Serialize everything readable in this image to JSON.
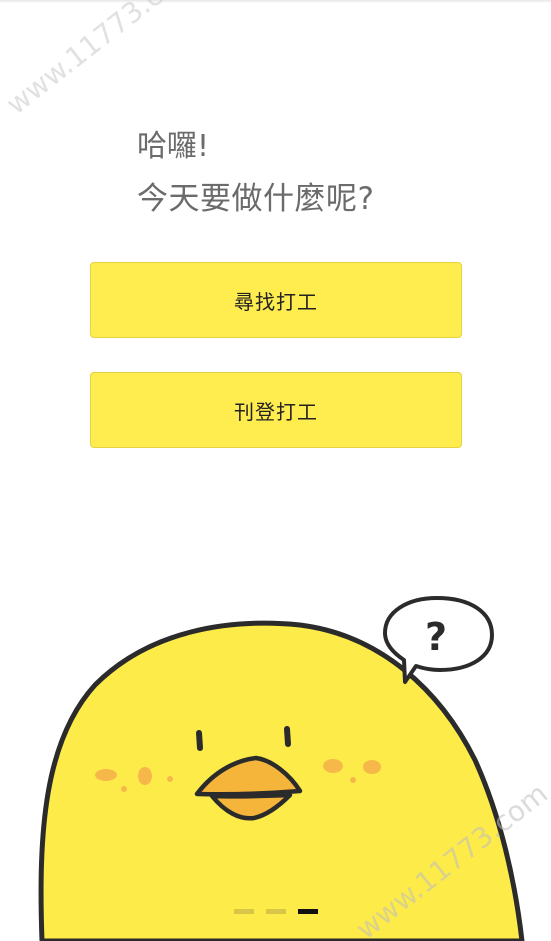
{
  "greeting": {
    "line1": "哈囉!",
    "line2": "今天要做什麼呢?"
  },
  "buttons": {
    "find_job": "尋找打工",
    "post_job": "刊登打工"
  },
  "speech_bubble": {
    "text": "?"
  },
  "watermark": {
    "text": "www.11773.com"
  },
  "page_indicator": {
    "total": 3,
    "active_index": 2
  },
  "colors": {
    "button_fill": "#ffec4f",
    "chick_body": "#fdeb4a",
    "beak": "#f5b53a",
    "blush": "#f7b04a",
    "greeting_text": "#6b6b6b"
  }
}
